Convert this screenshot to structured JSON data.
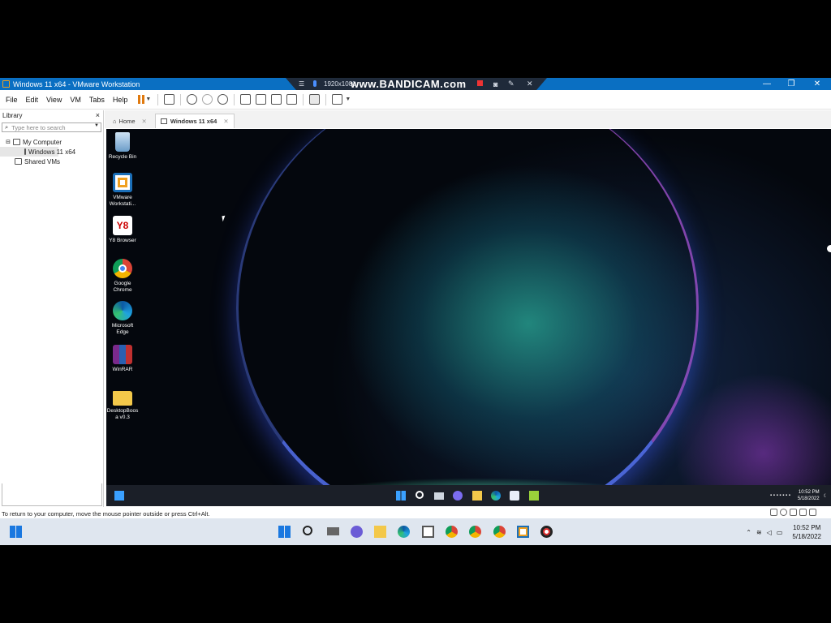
{
  "window": {
    "title": "Windows 11 x64 - VMware Workstation",
    "recorder_resolution": "1920x1080",
    "recorder_watermark": "www.BANDICAM.com"
  },
  "menu": {
    "items": [
      "File",
      "Edit",
      "View",
      "VM",
      "Tabs",
      "Help"
    ]
  },
  "library": {
    "header": "Library",
    "close": "×",
    "search_placeholder": "Type here to search",
    "tree": {
      "root": "My Computer",
      "vm": "Windows 11 x64",
      "shared": "Shared VMs"
    }
  },
  "tabs": {
    "home": "Home",
    "vm": "Windows 11 x64"
  },
  "desktop_icons": [
    {
      "label": "Recycle Bin",
      "icon": "recycle-bin-icon"
    },
    {
      "label": "VMware Workstati...",
      "icon": "vmware-icon"
    },
    {
      "label": "Y8 Browser",
      "icon": "y8-browser-icon"
    },
    {
      "label": "Google Chrome",
      "icon": "chrome-icon"
    },
    {
      "label": "Microsoft Edge",
      "icon": "edge-icon"
    },
    {
      "label": "WinRAR",
      "icon": "winrar-icon"
    },
    {
      "label": "DesktopBoos a v0.3",
      "icon": "folder-icon"
    }
  ],
  "guest_clock": {
    "time": "10:52 PM",
    "date": "5/18/2022"
  },
  "status_bar": {
    "text": "To return to your computer, move the mouse pointer outside or press Ctrl+Alt."
  },
  "host_clock": {
    "time": "10:52 PM",
    "date": "5/18/2022"
  },
  "colors": {
    "titlebar": "#0a6fc2",
    "accent_orange": "#e07a10",
    "host_taskbar": "#dfe6ef",
    "guest_taskbar": "#1b1f28"
  }
}
